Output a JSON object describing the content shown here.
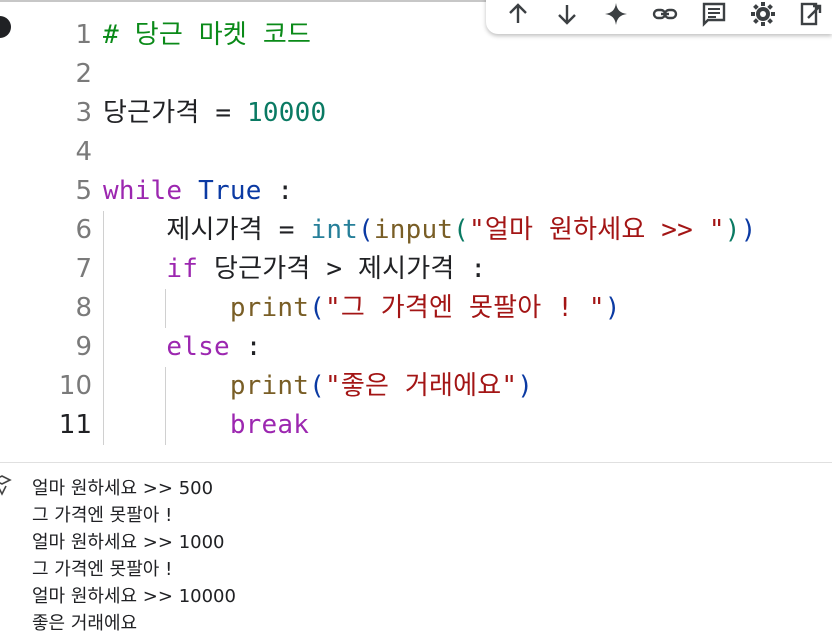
{
  "code_lines": [
    {
      "num": "1",
      "parts": [
        {
          "t": "# 당근 마켓 코드",
          "c": "comment"
        }
      ]
    },
    {
      "num": "2",
      "parts": []
    },
    {
      "num": "3",
      "parts": [
        {
          "t": "당근가격 = ",
          "c": "op"
        },
        {
          "t": "10000",
          "c": "num"
        }
      ]
    },
    {
      "num": "4",
      "parts": []
    },
    {
      "num": "5",
      "parts": [
        {
          "t": "while",
          "c": "kw"
        },
        {
          "t": " ",
          "c": "op"
        },
        {
          "t": "True",
          "c": "kw-true"
        },
        {
          "t": " :",
          "c": "op"
        }
      ]
    },
    {
      "num": "6",
      "parts": [
        {
          "t": "    제시가격 = ",
          "c": "op"
        },
        {
          "t": "int",
          "c": "fn-int"
        },
        {
          "t": "(",
          "c": "paren1"
        },
        {
          "t": "input",
          "c": "fn"
        },
        {
          "t": "(",
          "c": "paren2"
        },
        {
          "t": "\"얼마 원하세요 >> \"",
          "c": "str"
        },
        {
          "t": ")",
          "c": "paren2"
        },
        {
          "t": ")",
          "c": "paren1"
        }
      ]
    },
    {
      "num": "7",
      "parts": [
        {
          "t": "    ",
          "c": "op"
        },
        {
          "t": "if",
          "c": "kw"
        },
        {
          "t": " 당근가격 > 제시가격 :",
          "c": "op"
        }
      ]
    },
    {
      "num": "8",
      "parts": [
        {
          "t": "        ",
          "c": "op"
        },
        {
          "t": "print",
          "c": "fn"
        },
        {
          "t": "(",
          "c": "paren1"
        },
        {
          "t": "\"그 가격엔 못팔아 ! \"",
          "c": "str"
        },
        {
          "t": ")",
          "c": "paren1"
        }
      ]
    },
    {
      "num": "9",
      "parts": [
        {
          "t": "    ",
          "c": "op"
        },
        {
          "t": "else",
          "c": "kw"
        },
        {
          "t": " :",
          "c": "op"
        }
      ]
    },
    {
      "num": "10",
      "parts": [
        {
          "t": "        ",
          "c": "op"
        },
        {
          "t": "print",
          "c": "fn"
        },
        {
          "t": "(",
          "c": "paren1"
        },
        {
          "t": "\"좋은 거래에요\"",
          "c": "str"
        },
        {
          "t": ")",
          "c": "paren1"
        }
      ]
    },
    {
      "num": "11",
      "parts": [
        {
          "t": "        ",
          "c": "op"
        },
        {
          "t": "break",
          "c": "kw"
        }
      ]
    }
  ],
  "active_line": "11",
  "toolbar": {
    "buttons": [
      {
        "name": "move-cell-up-button",
        "icon": "arrow-up-icon"
      },
      {
        "name": "move-cell-down-button",
        "icon": "arrow-down-icon"
      },
      {
        "name": "gemini-button",
        "icon": "sparkle-icon"
      },
      {
        "name": "copy-link-button",
        "icon": "link-icon"
      },
      {
        "name": "add-comment-button",
        "icon": "comment-icon"
      },
      {
        "name": "cell-settings-button",
        "icon": "gear-icon"
      },
      {
        "name": "mirror-cell-button",
        "icon": "mirror-icon"
      }
    ]
  },
  "output": {
    "lines": [
      "얼마 원하세요 >> 500",
      "그 가격엔 못팔아 !",
      "얼마 원하세요 >> 1000",
      "그 가격엔 못팔아 !",
      "얼마 원하세요 >> 10000",
      "좋은 거래에요"
    ]
  },
  "colors": {
    "keyword": "#9c27b0",
    "boolean": "#0b3aa3",
    "number": "#0a7a63",
    "comment": "#0a8a18",
    "function": "#795e26",
    "string": "#a31515"
  }
}
